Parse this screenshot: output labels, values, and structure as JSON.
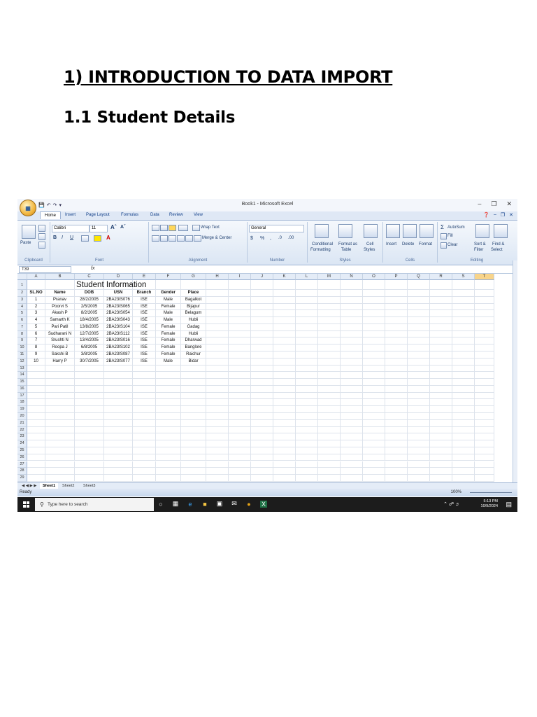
{
  "document": {
    "heading": "1)  INTRODUCTION TO DATA IMPORT",
    "subheading": "1.1 Student Details"
  },
  "excel": {
    "window_title": "Book1 - Microsoft Excel",
    "tabs": [
      "Home",
      "Insert",
      "Page Layout",
      "Formulas",
      "Data",
      "Review",
      "View"
    ],
    "ribbon": {
      "clipboard": {
        "label": "Clipboard",
        "paste": "Paste"
      },
      "font": {
        "label": "Font",
        "name": "Calibri",
        "size": "11"
      },
      "alignment": {
        "label": "Alignment",
        "wrap": "Wrap Text",
        "merge": "Merge & Center"
      },
      "number": {
        "label": "Number",
        "format": "General"
      },
      "styles": {
        "label": "Styles",
        "conditional": "Conditional",
        "formatting": "Formatting",
        "format_as": "Format as",
        "table": "Table",
        "cell": "Cell",
        "cell_styles": "Styles"
      },
      "cells": {
        "label": "Cells",
        "insert": "Insert",
        "delete": "Delete",
        "format": "Format"
      },
      "editing": {
        "label": "Editing",
        "autosum": "AutoSum",
        "fill": "Fill",
        "clear": "Clear",
        "sort": "Sort &",
        "filter": "Filter",
        "find": "Find &",
        "select": "Select"
      }
    },
    "name_box": "T39",
    "fx": "fx",
    "columns": [
      "A",
      "B",
      "C",
      "D",
      "E",
      "F",
      "G",
      "H",
      "I",
      "J",
      "K",
      "L",
      "M",
      "N",
      "O",
      "P",
      "Q",
      "R",
      "S",
      "T"
    ],
    "sheet_title": "Student  Information",
    "table_headers": [
      "SL.NO",
      "Name",
      "DOB",
      "USN",
      "Branch",
      "Gender",
      "Place"
    ],
    "rows": [
      [
        "1",
        "Pranav",
        "28/2/2005",
        "2BA23IS076",
        "ISE",
        "Male",
        "Bagalkot"
      ],
      [
        "2",
        "Poorvi S",
        "2/5/2005",
        "2BA23IS065",
        "ISE",
        "Female",
        "Bijapur"
      ],
      [
        "3",
        "Akash P",
        "8/2/2005",
        "2BA23IS054",
        "ISE",
        "Male",
        "Belagum"
      ],
      [
        "4",
        "Samarth K",
        "18/4/2005",
        "2BA23IS043",
        "ISE",
        "Male",
        "Hubli"
      ],
      [
        "5",
        "Pari Patil",
        "13/8/2005",
        "2BA23IS104",
        "ISE",
        "Female",
        "Gadag"
      ],
      [
        "6",
        "Sudharani N",
        "12/7/2005",
        "2BA23IS112",
        "ISE",
        "Female",
        "Hubli"
      ],
      [
        "7",
        "Srushti N",
        "13/4/2005",
        "2BA23IS016",
        "ISE",
        "Female",
        "Dharwad"
      ],
      [
        "8",
        "Roopa J",
        "6/8/2005",
        "2BA23IS102",
        "ISE",
        "Female",
        "Banglore"
      ],
      [
        "9",
        "Sakshi B",
        "3/8/2005",
        "2BA23IS087",
        "ISE",
        "Female",
        "Raichur"
      ],
      [
        "10",
        "Harry P",
        "30/7/2005",
        "2BA23IS077",
        "ISE",
        "Male",
        "Bidar"
      ]
    ],
    "row_count": 29,
    "sheet_tabs": [
      "Sheet1",
      "Sheet2",
      "Sheet3"
    ],
    "status": "Ready",
    "zoom": "100%"
  },
  "taskbar": {
    "search_placeholder": "Type here to search",
    "time": "5:13 PM",
    "date": "10/9/2024"
  }
}
